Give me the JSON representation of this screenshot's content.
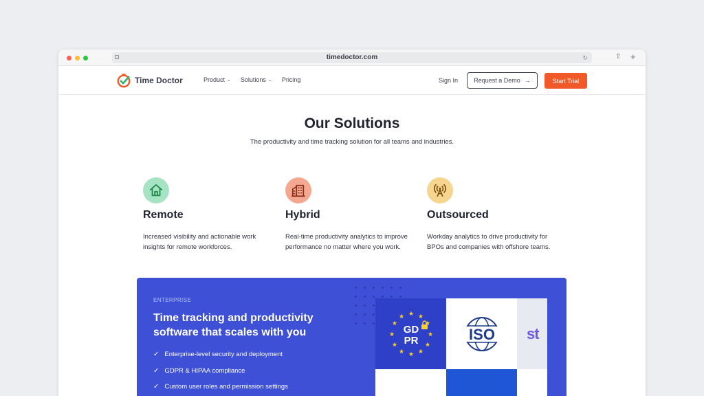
{
  "browser": {
    "url": "timedoctor.com"
  },
  "nav": {
    "brand": "Time Doctor",
    "links": [
      {
        "label": "Product",
        "has_dropdown": true
      },
      {
        "label": "Solutions",
        "has_dropdown": true
      },
      {
        "label": "Pricing",
        "has_dropdown": false
      }
    ],
    "sign_in": "Sign In",
    "request_demo": "Request a Demo",
    "start_trial": "Start Trial"
  },
  "hero": {
    "title": "Our Solutions",
    "subtitle": "The productivity and time tracking solution for all teams and industries."
  },
  "solutions": [
    {
      "icon": "house-icon",
      "title": "Remote",
      "description": "Increased visibility and actionable work insights for remote workforces.",
      "icon_bg": "#a6e3c3",
      "icon_color": "#1f8a4a"
    },
    {
      "icon": "buildings-icon",
      "title": "Hybrid",
      "description": "Real-time productivity analytics to improve performance no matter where you work.",
      "icon_bg": "#f5a891",
      "icon_color": "#8a2d18"
    },
    {
      "icon": "antenna-icon",
      "title": "Outsourced",
      "description": "Workday analytics to drive productivity for BPOs and companies with offshore teams.",
      "icon_bg": "#f6d58e",
      "icon_color": "#7a4a10"
    }
  ],
  "enterprise": {
    "label": "ENTERPRISE",
    "title": "Time tracking and productivity software that scales with you",
    "features": [
      "Enterprise-level security and deployment",
      "GDPR & HIPAA compliance",
      "Custom user roles and permission settings"
    ],
    "badges": [
      {
        "name": "GDPR",
        "line1": "GD",
        "line2": "PR"
      },
      {
        "name": "ISO",
        "text": "ISO"
      },
      {
        "name": "st",
        "text": "st"
      }
    ]
  },
  "colors": {
    "accent": "#f05a28",
    "enterprise_bg": "#3d50d6"
  }
}
